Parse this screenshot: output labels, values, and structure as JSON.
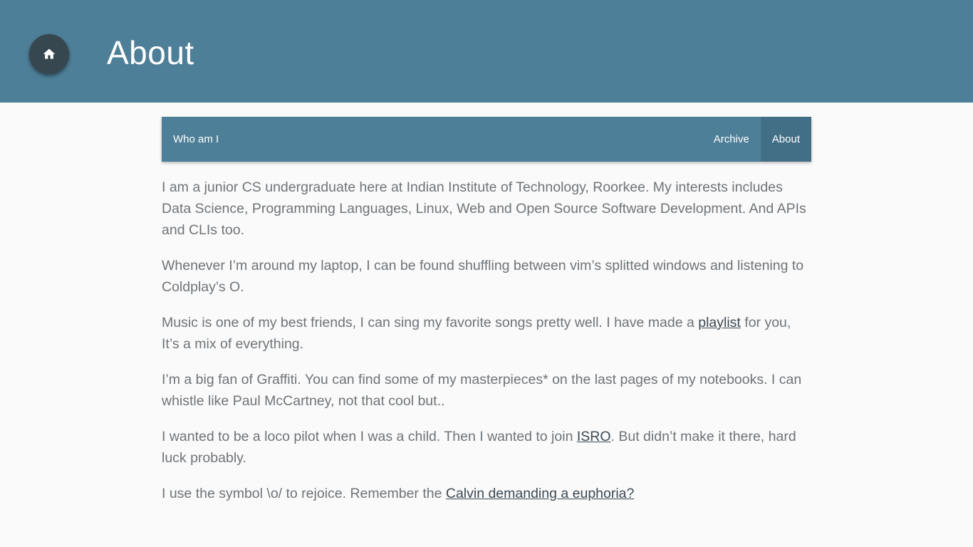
{
  "header": {
    "title": "About",
    "home_icon": "home-icon",
    "background": "#4e7f98",
    "fab_color": "#37474f"
  },
  "navbar": {
    "brand": "Who am I",
    "links": [
      {
        "label": "Archive",
        "active": false
      },
      {
        "label": "About",
        "active": true
      }
    ]
  },
  "content": {
    "p1": "I am a junior CS undergraduate here at Indian Institute of Technology, Roorkee. My interests includes Data Science, Programming Languages, Linux, Web and Open Source Software Development. And APIs and CLIs too.",
    "p2": "Whenever I’m around my laptop, I can be found shuffling between vim’s splitted windows and listening to Coldplay’s O.",
    "p3_before": "Music is one of my best friends, I can sing my favorite songs pretty well. I have made a ",
    "p3_link": "playlist",
    "p3_after": " for you, It’s a mix of everything.",
    "p4": "I’m a big fan of Graffiti. You can find some of my masterpieces* on the last pages of my notebooks. I can whistle like Paul McCartney, not that cool but..",
    "p5_before": "I wanted to be a loco pilot when I was a child. Then I wanted to join ",
    "p5_link": "ISRO",
    "p5_after": ". But didn’t make it there, hard luck probably.",
    "p6_before": "I use the symbol \\o/ to rejoice. Remember the ",
    "p6_link": "Calvin demanding a euphoria?"
  }
}
